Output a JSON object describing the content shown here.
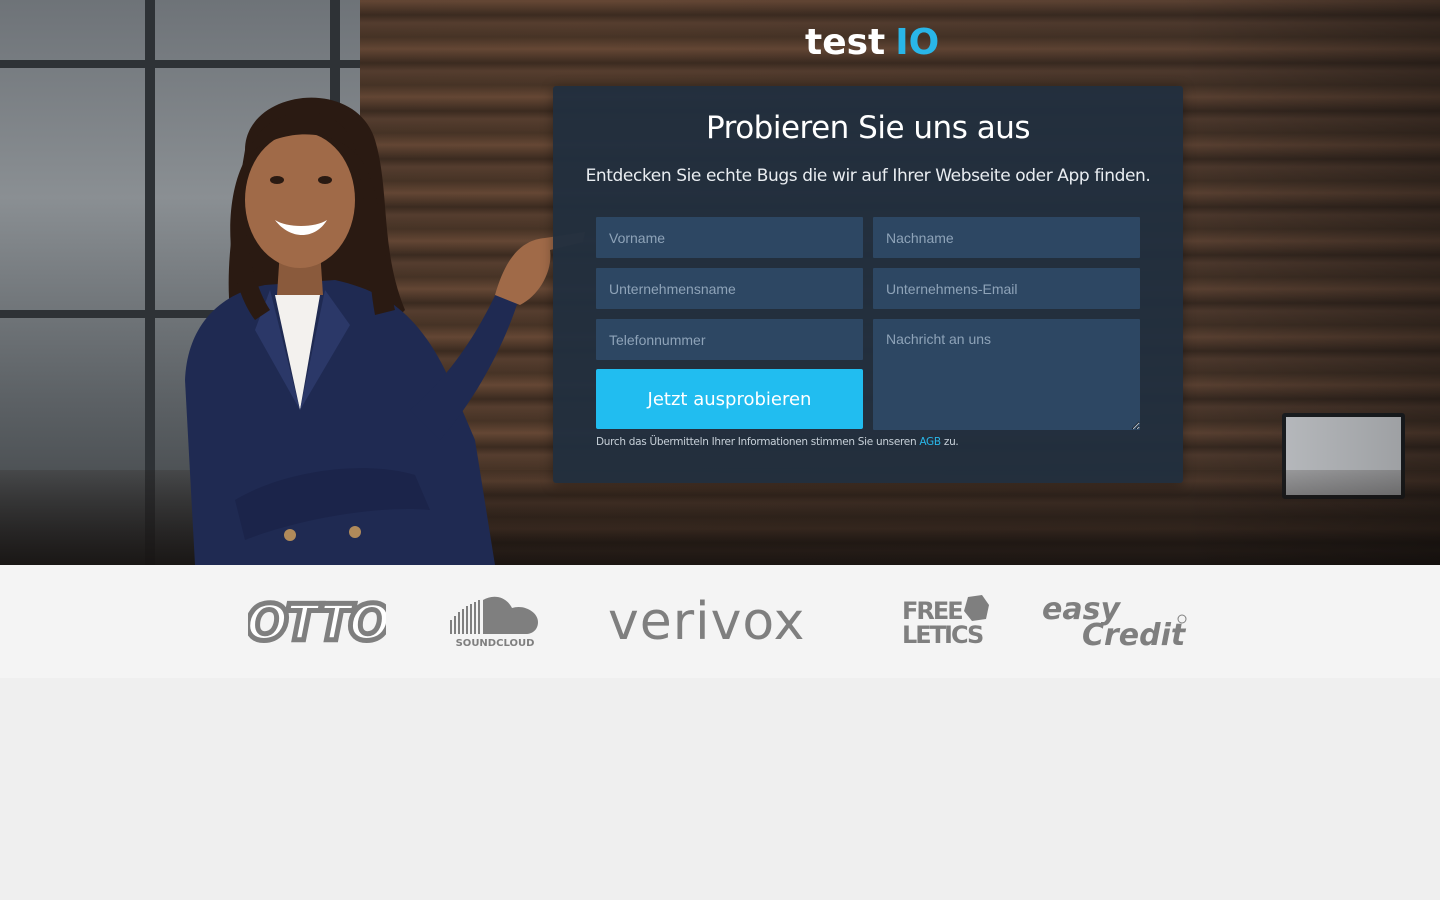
{
  "brand": {
    "logo_left": "test",
    "logo_right": "IO"
  },
  "form": {
    "title": "Probieren Sie uns aus",
    "subtitle": "Entdecken Sie echte Bugs die wir auf Ihrer Webseite oder App finden.",
    "first_name_placeholder": "Vorname",
    "last_name_placeholder": "Nachname",
    "company_placeholder": "Unternehmensname",
    "email_placeholder": "Unternehmens-Email",
    "phone_placeholder": "Telefonnummer",
    "message_placeholder": "Nachricht an uns",
    "submit_label": "Jetzt ausprobieren",
    "terms_prefix": "Durch das Übermitteln Ihrer Informationen stimmen Sie unseren",
    "terms_link": "AGB",
    "terms_suffix": "zu."
  },
  "customer_logos": {
    "otto": "OTTO",
    "soundcloud": "SOUNDCLOUD",
    "verivox": "verivox",
    "freeletics_line1": "FREE",
    "freeletics_line2": "LETICS",
    "easycredit_line1": "easy",
    "easycredit_line2": "Credit"
  },
  "colors": {
    "accent": "#21bdf0",
    "card": "#212f3e",
    "field": "#2d4763"
  }
}
